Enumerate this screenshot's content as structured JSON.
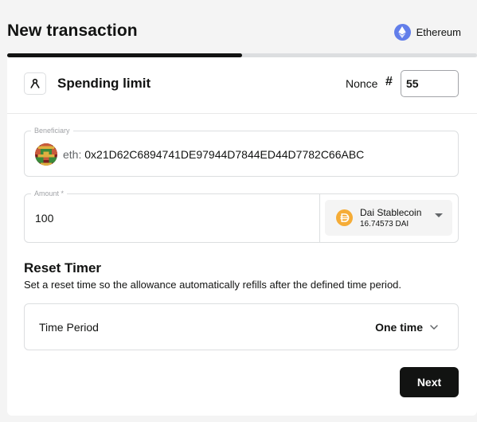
{
  "header": {
    "title": "New transaction",
    "chain_name": "Ethereum",
    "progress_fraction": 0.5
  },
  "form": {
    "type_title": "Spending limit",
    "nonce_label": "Nonce",
    "nonce_hash": "#",
    "nonce_value": "55",
    "beneficiary": {
      "legend": "Beneficiary",
      "prefix": "eth:",
      "address": "0x21D62C6894741DE97944D7844ED44D7782C66ABC"
    },
    "amount": {
      "legend": "Amount *",
      "value": "100"
    },
    "token": {
      "name": "Dai Stablecoin",
      "balance": "16.74573 DAI",
      "color": "#f5ac37"
    },
    "reset_timer": {
      "title": "Reset Timer",
      "description": "Set a reset time so the allowance automatically refills after the defined time period.",
      "period_label": "Time Period",
      "period_value": "One time"
    },
    "next_label": "Next"
  }
}
